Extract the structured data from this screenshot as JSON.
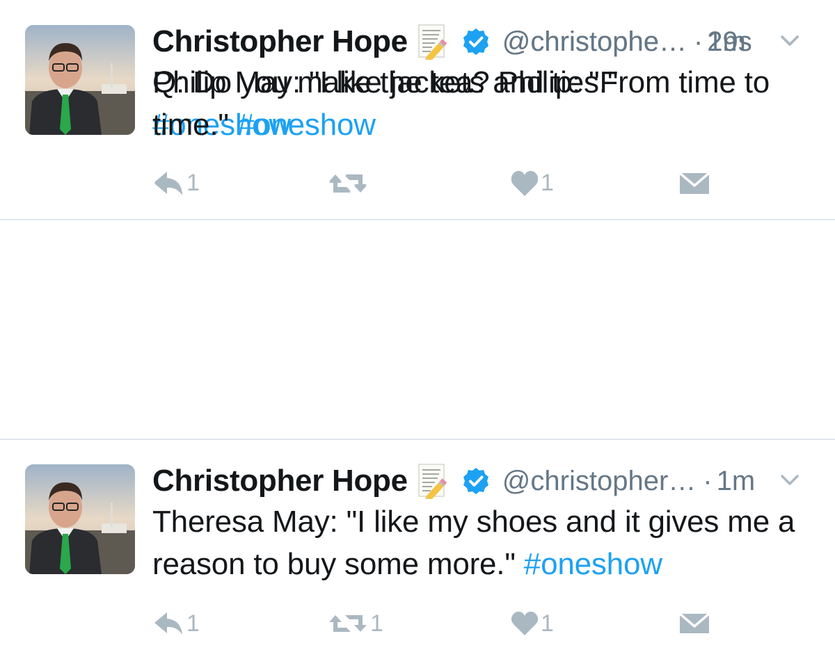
{
  "colors": {
    "text": "#14171a",
    "secondary": "#657786",
    "hashtag": "#1da1f2",
    "verified": "#1da1f2",
    "action_icon": "#aab8c2",
    "divider": "#e1e8ed"
  },
  "tweets": [
    {
      "author": {
        "name": "Christopher Hope",
        "handle": "@christophe…",
        "emoji_icon": "memo-icon",
        "verified": true
      },
      "separator": "·",
      "time": "19s",
      "text": "Philip May: \"I like jackets and ties.\"",
      "hashtag": "#oneshow",
      "actions": {
        "reply_count": "",
        "retweet_count": "",
        "like_count": ""
      }
    },
    {
      "author": {
        "name": "Christopher Hope",
        "handle": "@christopher…",
        "emoji_icon": "memo-icon",
        "verified": true
      },
      "separator": "·",
      "time": "1m",
      "text": "Theresa May: \"I like my shoes and it gives me a reason to buy some more.\"",
      "hashtag": "#oneshow",
      "actions": {
        "reply_count": "1",
        "retweet_count": "1",
        "like_count": "1"
      }
    },
    {
      "author": {
        "name": "Christopher Hope",
        "handle": "@christophe…",
        "emoji_icon": "memo-icon",
        "verified": true
      },
      "separator": "·",
      "time": "2m",
      "text": "Q: Do you make the tea? Philip: \"From time to time.\"",
      "hashtag": "#oneshow",
      "actions": {
        "reply_count": "1",
        "retweet_count": "",
        "like_count": "1"
      }
    }
  ]
}
